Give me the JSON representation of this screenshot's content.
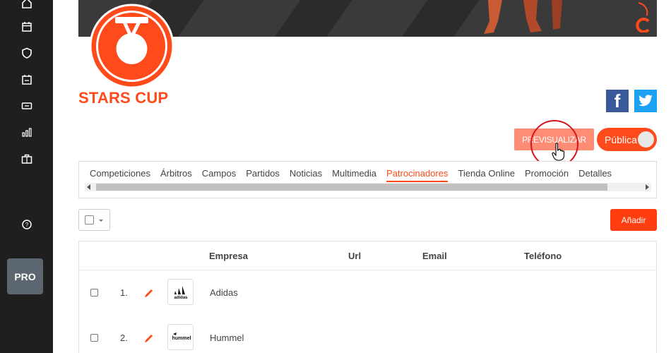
{
  "sidebar": {
    "icons": [
      "home-icon",
      "calendar-icon",
      "shield-icon",
      "calendar-event-icon",
      "ticket-icon",
      "bar-chart-icon",
      "briefcase-icon",
      "help-icon"
    ],
    "pro_label": "PRO"
  },
  "competition": {
    "title": "STARS CUP"
  },
  "social": {
    "facebook": "f",
    "twitter_icon": "twitter-icon"
  },
  "actions": {
    "preview_label": "PREVISUALIZAR",
    "visibility_label": "Pública",
    "add_label": "Añadir"
  },
  "tabs": [
    {
      "label": "Competiciones",
      "active": false
    },
    {
      "label": "Árbitros",
      "active": false
    },
    {
      "label": "Campos",
      "active": false
    },
    {
      "label": "Partidos",
      "active": false
    },
    {
      "label": "Noticias",
      "active": false
    },
    {
      "label": "Multimedia",
      "active": false
    },
    {
      "label": "Patrocinadores",
      "active": true
    },
    {
      "label": "Tienda Online",
      "active": false
    },
    {
      "label": "Promoción",
      "active": false
    },
    {
      "label": "Detalles",
      "active": false
    }
  ],
  "table": {
    "columns": [
      "Empresa",
      "Url",
      "Email",
      "Teléfono"
    ],
    "rows": [
      {
        "num": "1.",
        "company": "Adidas",
        "logo_text": "adidas"
      },
      {
        "num": "2.",
        "company": "Hummel",
        "logo_text": "hummel"
      }
    ]
  },
  "colors": {
    "accent": "#ff4a1c",
    "preview_button": "#ff8c75",
    "sidebar": "#1f1f1f"
  }
}
